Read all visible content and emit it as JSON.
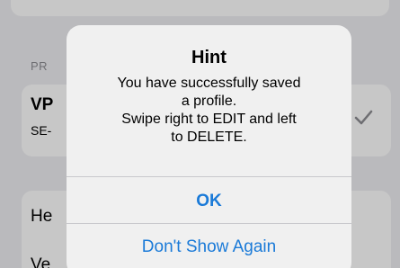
{
  "background": {
    "section_header": "PR",
    "profile_row": {
      "title": "VP",
      "subtitle": "SE-",
      "check_icon": "checkmark-icon"
    },
    "row2_label": "He",
    "row3_label": "Ve"
  },
  "alert": {
    "title": "Hint",
    "message_lines": [
      "You have successfully saved",
      "a profile.",
      "Swipe right to EDIT and left",
      "to DELETE."
    ],
    "ok_label": "OK",
    "dont_show_label": "Don't Show Again",
    "button_color": "#1a7ad8"
  }
}
